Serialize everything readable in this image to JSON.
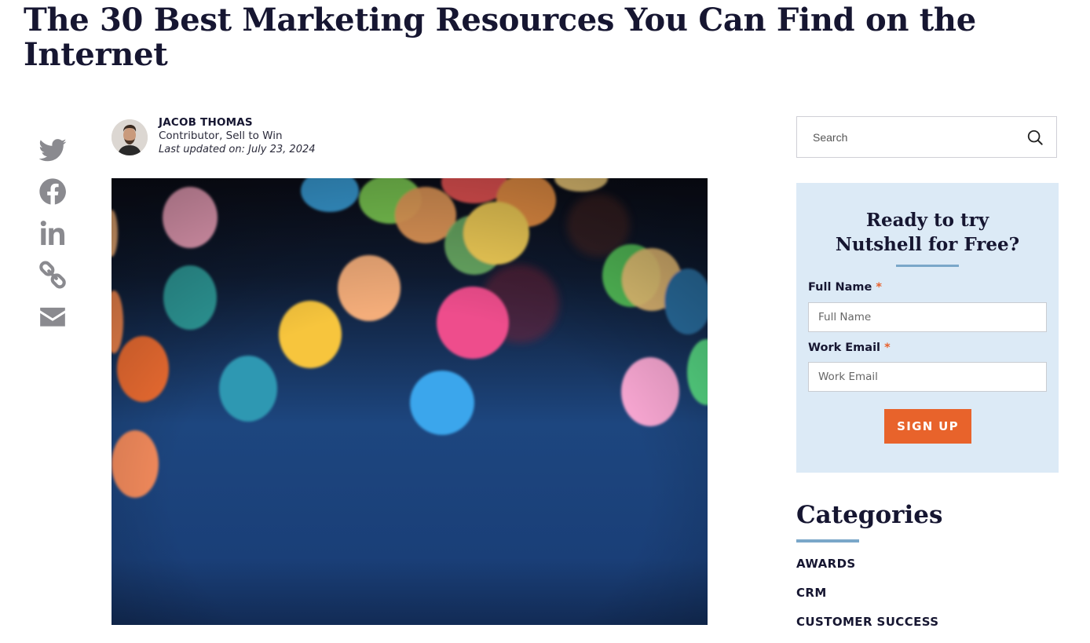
{
  "article": {
    "title": "The 30 Best Marketing Resources You Can Find on the Internet"
  },
  "share": {
    "icons": [
      "twitter-icon",
      "facebook-icon",
      "linkedin-icon",
      "link-icon",
      "email-icon"
    ],
    "icon_color": "#8a8a8f"
  },
  "author": {
    "name": "JACOB THOMAS",
    "role": "Contributor, Sell to Win",
    "updated": "Last updated on: July 23, 2024"
  },
  "sidebar": {
    "search": {
      "placeholder": "Search"
    },
    "signup": {
      "title_line1": "Ready to try",
      "title_line2": "Nutshell for Free?",
      "full_name_label": "Full Name",
      "full_name_placeholder": "Full Name",
      "work_email_label": "Work Email",
      "work_email_placeholder": "Work Email",
      "required_mark": "*",
      "button": "SIGN UP",
      "background": "#dceaf6",
      "button_color": "#e8632b"
    },
    "categories": {
      "heading": "Categories",
      "items": [
        {
          "label": "AWARDS"
        },
        {
          "label": "CRM"
        },
        {
          "label": "CUSTOMER SUCCESS"
        }
      ]
    }
  }
}
